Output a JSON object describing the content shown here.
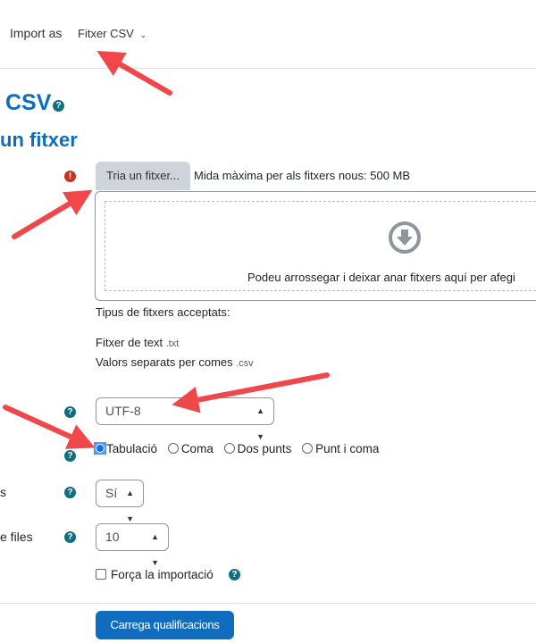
{
  "header": {
    "import_as_label": "Import as",
    "import_format": "Fitxer CSV"
  },
  "page": {
    "title": "CSV",
    "section_title": "un fitxer"
  },
  "file": {
    "choose_button": "Tria un fitxer...",
    "max_size": "Mida màxima per als fitxers nous: 500 MB",
    "drop_text": "Podeu arrossegar i deixar anar fitxers aquí per afegi",
    "accepted_label": "Tipus de fitxers acceptats:",
    "types": [
      {
        "name": "Fitxer de text",
        "ext": ".txt"
      },
      {
        "name": "Valors separats per comes",
        "ext": ".csv"
      }
    ]
  },
  "encoding": {
    "value": "UTF-8"
  },
  "separator": {
    "options": [
      "Tabulació",
      "Coma",
      "Dos punts",
      "Punt i coma"
    ],
    "selected": "Tabulació"
  },
  "verbose": {
    "label_fragment": "s",
    "value": "Sí"
  },
  "preview": {
    "label_fragment": "e files",
    "value": "10"
  },
  "force": {
    "label": "Força la importació",
    "checked": false
  },
  "submit": {
    "label": "Carrega qualificacions"
  },
  "colors": {
    "accent": "#0f6cbf",
    "arrow": "#f0474a",
    "error": "#ca3120",
    "help": "#0f6e84"
  }
}
